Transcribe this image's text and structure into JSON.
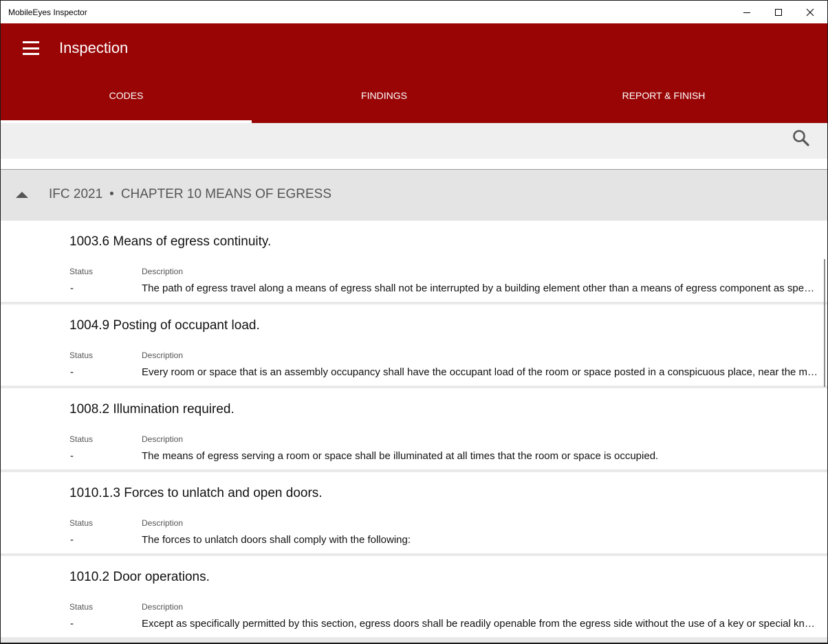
{
  "window": {
    "title": "MobileEyes Inspector"
  },
  "appbar": {
    "title": "Inspection",
    "tabs": [
      {
        "label": "CODES",
        "active": true
      },
      {
        "label": "FINDINGS",
        "active": false
      },
      {
        "label": "REPORT & FINISH",
        "active": false
      }
    ]
  },
  "colors": {
    "brand": "#990505",
    "group_header_bg": "#e4e4e4",
    "search_bar_bg": "#efefef"
  },
  "icons": {
    "menu": "hamburger-icon",
    "search": "search-icon",
    "collapse": "caret-up-icon",
    "minimize": "minimize-icon",
    "maximize": "maximize-icon",
    "close": "close-icon"
  },
  "group": {
    "code_book": "IFC 2021",
    "separator": "•",
    "chapter": "CHAPTER 10 MEANS OF EGRESS"
  },
  "columns": {
    "status": "Status",
    "description": "Description"
  },
  "items": [
    {
      "title": "1003.6 Means of egress continuity.",
      "status": "-",
      "description": "The path of egress travel along a means of egress shall not be interrupted by a building element other than a means of egress component as specifically allowed in this chapter."
    },
    {
      "title": "1004.9 Posting of occupant load.",
      "status": "-",
      "description": "Every room or space that is an assembly occupancy shall have the occupant load of the room or space posted in a conspicuous place, near the main exit or exit access doorway from the room or space."
    },
    {
      "title": "1008.2 Illumination required.",
      "status": "-",
      "description": "The means of egress serving a room or space shall be illuminated at all times that the room or space is occupied."
    },
    {
      "title": "1010.1.3 Forces to unlatch and open doors.",
      "status": "-",
      "description": "The forces to unlatch doors shall comply with the following:"
    },
    {
      "title": "1010.2 Door operations.",
      "status": "-",
      "description": "Except as specifically permitted by this section, egress doors shall be readily openable from the egress side without the use of a key or special knowledge or effort."
    }
  ]
}
